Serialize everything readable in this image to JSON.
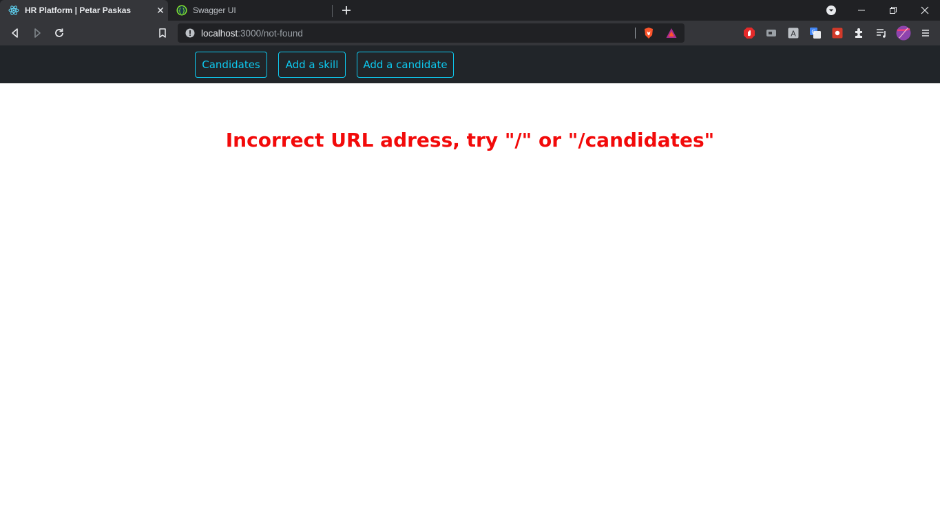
{
  "browser": {
    "tabs": [
      {
        "title": "HR Platform | Petar Paskas",
        "icon": "react-icon",
        "active": true
      },
      {
        "title": "Swagger UI",
        "icon": "swagger-icon",
        "active": false
      }
    ],
    "address_bar": {
      "host": "localhost",
      "path": ":3000/not-found"
    }
  },
  "nav": {
    "candidates_label": "Candidates",
    "add_skill_label": "Add a skill",
    "add_candidate_label": "Add a candidate"
  },
  "main": {
    "error_message": "Incorrect URL adress, try \"/\" or \"/candidates\""
  },
  "colors": {
    "nav_background": "#212529",
    "nav_accent": "#0dcaf0",
    "error_text": "#f20a0a"
  }
}
